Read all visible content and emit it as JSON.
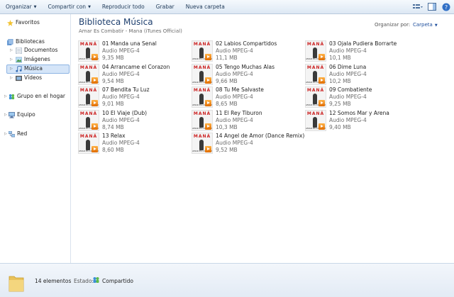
{
  "toolbar": {
    "organize": "Organizar",
    "share": "Compartir con",
    "play_all": "Reproducir todo",
    "burn": "Grabar",
    "new_folder": "Nueva carpeta"
  },
  "nav": {
    "favorites": "Favoritos",
    "libraries": "Bibliotecas",
    "documents": "Documentos",
    "images": "Imágenes",
    "music": "Música",
    "videos": "Vídeos",
    "homegroup": "Grupo en el hogar",
    "computer": "Equipo",
    "network": "Red"
  },
  "content": {
    "title": "Biblioteca Música",
    "subtitle": "Amar Es Combatir - Mana (iTunes Official)",
    "arrange_by_label": "Organizar por:",
    "arrange_by_value": "Carpeta"
  },
  "thumb_text": {
    "artist": "MANÁ",
    "album": "AMAR ES COMBATIR"
  },
  "files": [
    {
      "name": "01 Manda una Senal",
      "type": "Audio MPEG-4",
      "size": "9,35 MB"
    },
    {
      "name": "02 Labios Compartidos",
      "type": "Audio MPEG-4",
      "size": "11,1 MB"
    },
    {
      "name": "03 Ojala Pudiera Borrarte",
      "type": "Audio MPEG-4",
      "size": "10,1 MB"
    },
    {
      "name": "04 Arrancame el Corazon",
      "type": "Audio MPEG-4",
      "size": "9,54 MB"
    },
    {
      "name": "05 Tengo Muchas Alas",
      "type": "Audio MPEG-4",
      "size": "9,66 MB"
    },
    {
      "name": "06 Dime Luna",
      "type": "Audio MPEG-4",
      "size": "10,2 MB"
    },
    {
      "name": "07 Bendita Tu Luz",
      "type": "Audio MPEG-4",
      "size": "9,01 MB"
    },
    {
      "name": "08 Tu Me Salvaste",
      "type": "Audio MPEG-4",
      "size": "8,65 MB"
    },
    {
      "name": "09 Combatiente",
      "type": "Audio MPEG-4",
      "size": "9,25 MB"
    },
    {
      "name": "10 El Viaje (Dub)",
      "type": "Audio MPEG-4",
      "size": "8,74 MB"
    },
    {
      "name": "11 El Rey Tiburon",
      "type": "Audio MPEG-4",
      "size": "10,3 MB"
    },
    {
      "name": "12 Somos Mar y Arena",
      "type": "Audio MPEG-4",
      "size": "9,40 MB"
    },
    {
      "name": "13 Relax",
      "type": "Audio MPEG-4",
      "size": "8,60 MB"
    },
    {
      "name": "14 Angel de Amor (Dance Remix)",
      "type": "Audio MPEG-4",
      "size": "9,52 MB"
    }
  ],
  "status": {
    "count": "14 elementos",
    "state_label": "Estado:",
    "state_value": "Compartido"
  },
  "colors": {
    "title": "#1e3f6e",
    "selection": "#d5e5f8",
    "accent": "#1e4e9c"
  }
}
